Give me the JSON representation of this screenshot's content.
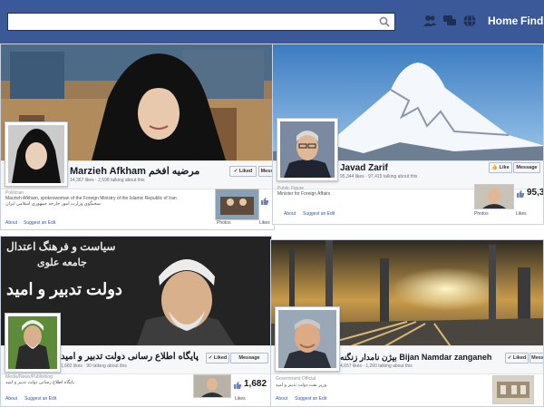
{
  "topbar": {
    "search_value": "",
    "home_label": "Home",
    "find_label": "Find F",
    "icons": [
      "friends-icon",
      "messages-icon",
      "notifications-icon"
    ],
    "brand_color": "#3b5998"
  },
  "panels": [
    {
      "name": "Marzieh Afkham",
      "name_rtl": "مرضیه افخم",
      "likes": "14,367 likes · 2,598 talking about this",
      "category": "Politician",
      "about": "Marzieh Afkham, spokeswoman of the Foreign Ministry of the Islamic Republic of Iran",
      "about_rtl": "سخنگوی وزارت امور خارجه جمهوری اسلامی ایران",
      "liked_label": "✓ Liked",
      "message_label": "Messa",
      "photos_label": "Photos",
      "likes_label": "Likes",
      "about_link": "About",
      "suggest_link": "Suggest an Edit"
    },
    {
      "name": "Javad Zarif",
      "likes": "95,344 likes · 97,415 talking about this",
      "category": "Public Figure",
      "about": "Minister for Foreign Affairs",
      "like_label": "👍 Like",
      "message_label": "Message",
      "likes_count": "95,3",
      "photos_label": "Photos",
      "likes_label": "Likes",
      "about_link": "About",
      "suggest_link": "Suggest an Edit"
    },
    {
      "cover_text_1": "سیاست و فرهنگ اعتدال",
      "cover_text_2": "جامعه علوی",
      "cover_text_3": "دولت تدبیر و امید",
      "name_rtl": "پایگاه اطلاع رسانی دولت تدبیر و امید",
      "likes": "1,682 likes · 90 talking about this",
      "category": "Media/News/Publishing",
      "about_rtl": "پایگاه اطلاع رسانی دولت تدبیر و امید",
      "liked_label": "✓ Liked",
      "message_label": "Message",
      "likes_count": "1,682",
      "likes_label": "Likes",
      "about_link": "About",
      "suggest_link": "Suggest an Edit"
    },
    {
      "name": "Bijan Namdar zanganeh",
      "name_rtl": "بیژن نامدار زنگنه",
      "likes": "4,657 likes · 1,260 talking about this",
      "category": "Government Official",
      "about_rtl": "وزیر نفت دولت تدبیر و امید",
      "liked_label": "✓ Liked",
      "message_label": "Mess",
      "about_link": "About",
      "suggest_link": "Suggest an Edit"
    }
  ]
}
